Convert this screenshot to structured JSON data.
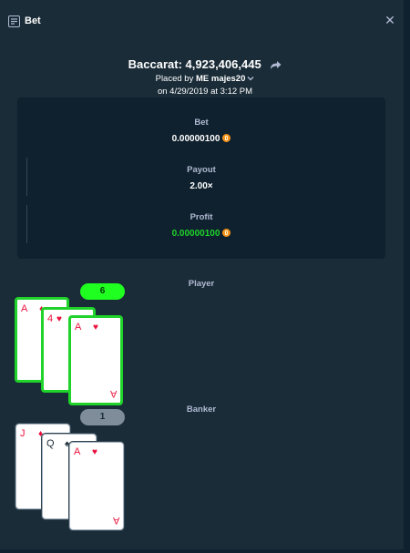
{
  "window": {
    "title": "Bet",
    "title_icon": "bet-slip-icon",
    "close_icon": "close-icon"
  },
  "bet": {
    "game_label": "Baccarat: 4,923,406,445",
    "placed_by_prefix": "Placed by",
    "placed_by_user": "ME majes20",
    "date_line": "on 4/29/2019 at 3:12 PM"
  },
  "stats": {
    "bet_label": "Bet",
    "bet_value": "0.00000100",
    "payout_label": "Payout",
    "payout_value": "2.00×",
    "profit_label": "Profit",
    "profit_value": "0.00000100",
    "currency_icon": "bitcoin-icon"
  },
  "player": {
    "label": "Player",
    "score": "6",
    "cards": [
      {
        "rank": "A",
        "suit": "♦",
        "color": "red"
      },
      {
        "rank": "4",
        "suit": "♥",
        "color": "red"
      },
      {
        "rank": "A",
        "suit": "♥",
        "color": "red"
      }
    ]
  },
  "banker": {
    "label": "Banker",
    "score": "1",
    "cards": [
      {
        "rank": "J",
        "suit": "♦",
        "color": "red"
      },
      {
        "rank": "Q",
        "suit": "♠",
        "color": "black"
      },
      {
        "rank": "A",
        "suit": "♥",
        "color": "red"
      }
    ]
  },
  "colors": {
    "background": "#1a2c38",
    "panel": "#0f212e",
    "win_green": "#1fff20",
    "profit_green": "#1fd32a",
    "muted_text": "#b1bad3",
    "heart_red": "#e9113c"
  }
}
